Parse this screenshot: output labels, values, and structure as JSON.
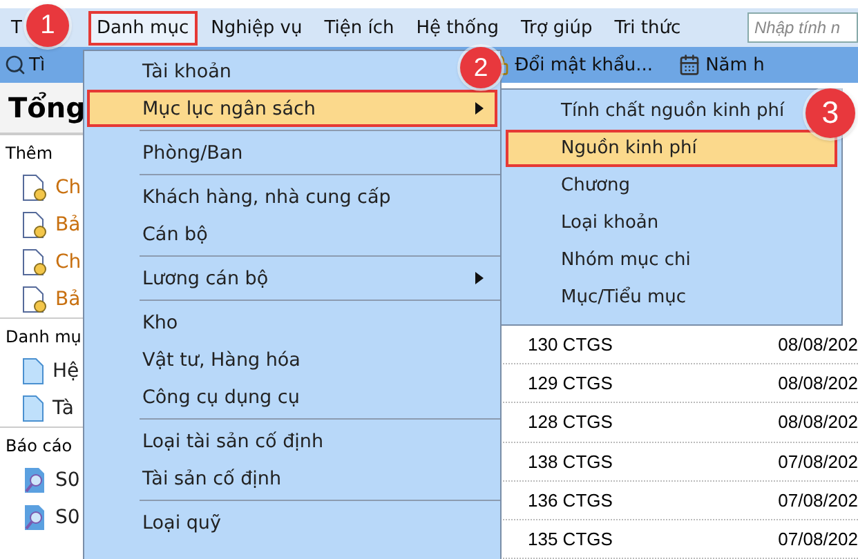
{
  "menubar": {
    "items": [
      {
        "label": "T",
        "selected": false
      },
      {
        "label": "Danh mục",
        "selected": true
      },
      {
        "label": "Nghiệp vụ",
        "selected": false
      },
      {
        "label": "Tiện ích",
        "selected": false
      },
      {
        "label": "Hệ thống",
        "selected": false
      },
      {
        "label": "Trợ giúp",
        "selected": false
      },
      {
        "label": "Tri thức",
        "selected": false
      }
    ],
    "search": {
      "placeholder": "Nhập tính n"
    }
  },
  "toolbar": {
    "items": [
      {
        "label": "Tì",
        "kind": "search"
      },
      {
        "label": "Đổi mật khẩu...",
        "kind": "lock"
      },
      {
        "label": "Năm h",
        "kind": "calendar"
      }
    ]
  },
  "left_panel": {
    "title": "Tổng",
    "sections": [
      {
        "label": "Thêm",
        "items": [
          {
            "label": "Ch",
            "kind": "new"
          },
          {
            "label": "Bả",
            "kind": "new"
          },
          {
            "label": "Ch",
            "kind": "new"
          },
          {
            "label": "Bả",
            "kind": "new"
          }
        ]
      },
      {
        "label": "Danh mụ",
        "items": [
          {
            "label": "Hệ",
            "kind": "doc"
          },
          {
            "label": "Tà",
            "kind": "doc"
          }
        ]
      },
      {
        "label": "Báo cáo",
        "items": [
          {
            "label": "S0",
            "kind": "report"
          },
          {
            "label": "S0",
            "kind": "report"
          }
        ]
      }
    ]
  },
  "grid": {
    "rows": [
      {
        "column_1": "130 CTGS",
        "column_2": "08/08/202"
      },
      {
        "column_1": "129 CTGS",
        "column_2": "08/08/202"
      },
      {
        "column_1": "128 CTGS",
        "column_2": "08/08/202"
      },
      {
        "column_1": "138 CTGS",
        "column_2": "07/08/202"
      },
      {
        "column_1": "136 CTGS",
        "column_2": "07/08/202"
      },
      {
        "column_1": "135 CTGS",
        "column_2": "07/08/202"
      }
    ]
  },
  "menu": {
    "items": [
      {
        "kind": "item",
        "label": "Tài khoản",
        "selected": false,
        "submenu": false
      },
      {
        "kind": "item",
        "label": "Mục lục ngân sách",
        "selected": true,
        "submenu": true
      },
      {
        "kind": "separator"
      },
      {
        "kind": "item",
        "label": "Phòng/Ban",
        "selected": false,
        "submenu": false
      },
      {
        "kind": "separator"
      },
      {
        "kind": "item",
        "label": "Khách hàng, nhà cung cấp",
        "selected": false,
        "submenu": false
      },
      {
        "kind": "item",
        "label": "Cán bộ",
        "selected": false,
        "submenu": false
      },
      {
        "kind": "separator"
      },
      {
        "kind": "item",
        "label": "Lương cán bộ",
        "selected": false,
        "submenu": true
      },
      {
        "kind": "separator"
      },
      {
        "kind": "item",
        "label": "Kho",
        "selected": false,
        "submenu": false
      },
      {
        "kind": "item",
        "label": "Vật tư, Hàng hóa",
        "selected": false,
        "submenu": false
      },
      {
        "kind": "item",
        "label": "Công cụ dụng cụ",
        "selected": false,
        "submenu": false
      },
      {
        "kind": "separator"
      },
      {
        "kind": "item",
        "label": "Loại tài sản cố định",
        "selected": false,
        "submenu": false
      },
      {
        "kind": "item",
        "label": "Tài sản cố định",
        "selected": false,
        "submenu": false
      },
      {
        "kind": "separator"
      },
      {
        "kind": "item",
        "label": "Loại quỹ",
        "selected": false,
        "submenu": false
      }
    ]
  },
  "submenu": {
    "items": [
      {
        "label": "Tính chất nguồn kinh phí",
        "selected": false
      },
      {
        "label": "Nguồn kinh phí",
        "selected": true
      },
      {
        "label": "Chương",
        "selected": false
      },
      {
        "label": "Loại khoản",
        "selected": false
      },
      {
        "label": "Nhóm mục chi",
        "selected": false
      },
      {
        "label": "Mục/Tiểu mục",
        "selected": false
      }
    ]
  },
  "callouts": [
    "1",
    "2",
    "3"
  ]
}
